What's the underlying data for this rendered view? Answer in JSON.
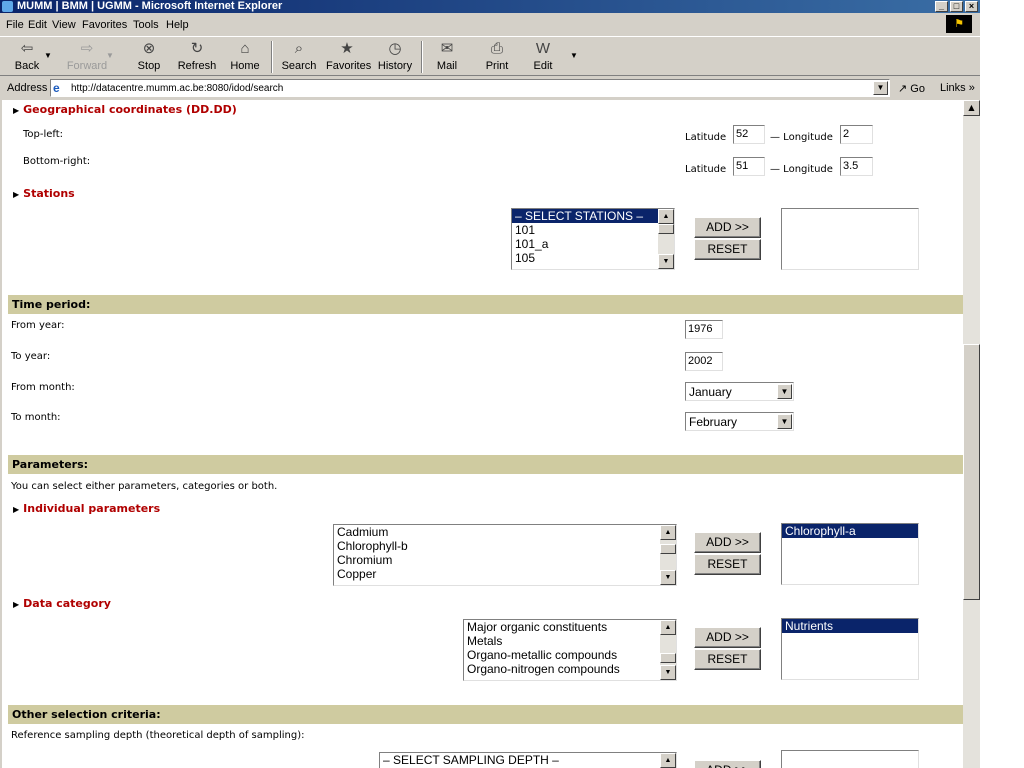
{
  "window": {
    "title": "MUMM | BMM | UGMM - Microsoft Internet Explorer",
    "buttons": {
      "minimize": "_",
      "maximize": "□",
      "close": "×"
    }
  },
  "menu": [
    "File",
    "Edit",
    "View",
    "Favorites",
    "Tools",
    "Help"
  ],
  "toolbar": {
    "back": "Back",
    "forward": "Forward",
    "stop": "Stop",
    "refresh": "Refresh",
    "home": "Home",
    "search": "Search",
    "favorites": "Favorites",
    "history": "History",
    "mail": "Mail",
    "print": "Print",
    "edit": "Edit"
  },
  "address": {
    "label": "Address",
    "url": "http://datacentre.mumm.ac.be:8080/idod/search",
    "go": "Go",
    "links": "Links »"
  },
  "geo": {
    "title": "Geographical coordinates (DD.DD)",
    "top_left": {
      "label": "Top-left:",
      "lat_label": "Latitude",
      "lat": "52",
      "sep": "— Longitude",
      "lon": "2"
    },
    "bottom_right": {
      "label": "Bottom-right:",
      "lat_label": "Latitude",
      "lat": "51",
      "sep": "— Longitude",
      "lon": "3.5"
    }
  },
  "stations": {
    "title": "Stations",
    "options": [
      "– SELECT STATIONS –",
      "101",
      "101_a",
      "105"
    ],
    "add": "ADD >>",
    "reset": "RESET"
  },
  "time": {
    "header": "Time period:",
    "from_year_label": "From year:",
    "from_year": "1976",
    "to_year_label": "To year:",
    "to_year": "2002",
    "from_month_label": "From month:",
    "from_month": "January",
    "to_month_label": "To month:",
    "to_month": "February"
  },
  "parameters": {
    "header": "Parameters:",
    "hint": "You can select either parameters, categories or both.",
    "individual_title": "Individual parameters",
    "individual_options": [
      "Cadmium",
      "Chlorophyll-b",
      "Chromium",
      "Copper"
    ],
    "individual_selected": [
      "Chlorophyll-a"
    ],
    "category_title": "Data category",
    "category_options": [
      "Major organic constituents",
      "Metals",
      "Organo-metallic compounds",
      "Organo-nitrogen compounds"
    ],
    "category_selected": [
      "Nutrients"
    ],
    "add": "ADD >>",
    "reset": "RESET"
  },
  "other": {
    "header": "Other selection criteria:",
    "depth_label": "Reference sampling depth (theoretical depth of sampling):",
    "depth_options": [
      "– SELECT SAMPLING DEPTH –"
    ],
    "add": "ADD >>"
  }
}
